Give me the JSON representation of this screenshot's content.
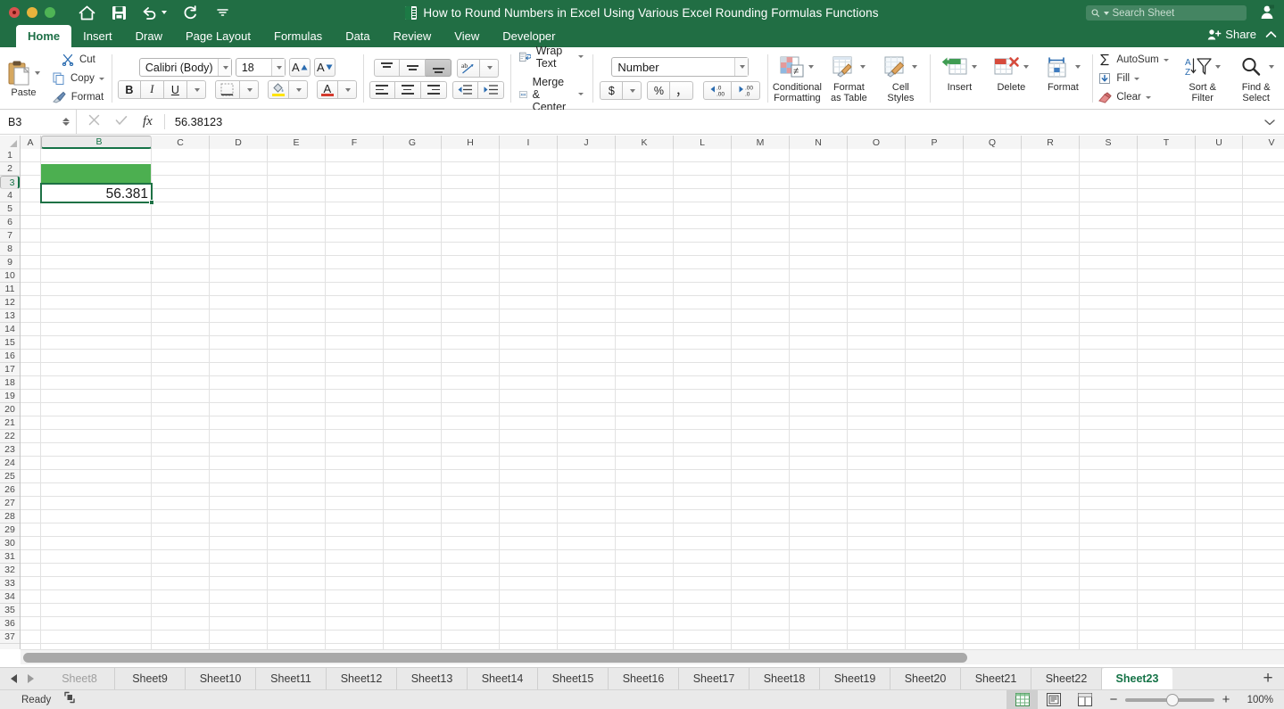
{
  "window": {
    "title": "How to Round Numbers in Excel Using Various Excel Rounding Formulas Functions",
    "traffic_lights": [
      "close",
      "minimize",
      "zoom"
    ],
    "quick_access": [
      "home-icon",
      "save-icon",
      "undo-icon",
      "redo-icon",
      "customize-icon"
    ]
  },
  "search": {
    "placeholder": "Search Sheet",
    "value": ""
  },
  "share": {
    "label": "Share",
    "collapse_icon": "chevron-up-icon",
    "account_icon": "person-icon"
  },
  "tabs": [
    {
      "label": "Home",
      "active": true
    },
    {
      "label": "Insert",
      "active": false
    },
    {
      "label": "Draw",
      "active": false
    },
    {
      "label": "Page Layout",
      "active": false
    },
    {
      "label": "Formulas",
      "active": false
    },
    {
      "label": "Data",
      "active": false
    },
    {
      "label": "Review",
      "active": false
    },
    {
      "label": "View",
      "active": false
    },
    {
      "label": "Developer",
      "active": false
    }
  ],
  "ribbon": {
    "clipboard": {
      "paste": "Paste",
      "cut": "Cut",
      "copy": "Copy",
      "format": "Format"
    },
    "font": {
      "name": "Calibri (Body)",
      "size": "18",
      "grow": "A",
      "shrink": "A",
      "bold": "B",
      "italic": "I",
      "underline": "U"
    },
    "alignment": {
      "top": "align-top",
      "middle": "align-middle",
      "bottom": "align-bottom",
      "orientation": "ab",
      "align_left": "align-left",
      "align_center": "align-center",
      "align_right": "align-right",
      "decrease_indent": "decrease-indent",
      "increase_indent": "increase-indent",
      "wrap_text": "Wrap Text",
      "merge_center": "Merge & Center"
    },
    "number": {
      "format": "Number",
      "currency": "$",
      "percent": "%",
      "comma": ",",
      "increase_decimal": ".00",
      "decrease_decimal": ".00"
    },
    "styles": {
      "conditional_formatting": "Conditional\nFormatting",
      "format_as_table": "Format\nas Table",
      "cell_styles": "Cell\nStyles"
    },
    "cells": {
      "insert": "Insert",
      "delete": "Delete",
      "format": "Format"
    },
    "editing": {
      "autosum": "AutoSum",
      "fill": "Fill",
      "clear": "Clear",
      "sort_filter": "Sort &\nFilter",
      "find_select": "Find &\nSelect"
    }
  },
  "formula_bar": {
    "name_box": "B3",
    "cancel_icon": "close-icon",
    "confirm_icon": "check-icon",
    "fx_icon": "fx-icon",
    "value": "56.38123",
    "collapse_icon": "chevron-down-icon"
  },
  "grid": {
    "columns": [
      "A",
      "B",
      "C",
      "D",
      "E",
      "F",
      "G",
      "H",
      "I",
      "J",
      "K",
      "L",
      "M",
      "N",
      "O",
      "P",
      "Q",
      "R",
      "S",
      "T",
      "U",
      "V"
    ],
    "selected_column": "B",
    "rows": [
      1,
      2,
      3,
      4,
      5,
      6,
      7,
      8,
      9,
      10,
      11,
      12,
      13,
      14,
      15,
      16,
      17,
      18,
      19,
      20,
      21,
      22,
      23,
      24,
      25,
      26,
      27,
      28,
      29,
      30,
      31,
      32,
      33,
      34,
      35,
      36,
      37
    ],
    "selected_row": 3,
    "cells": [
      {
        "ref": "B2",
        "value": "",
        "fill": "#4caf50"
      },
      {
        "ref": "B3",
        "value": "56.381",
        "fill": "#ffffff",
        "selected": true
      }
    ],
    "selection_color": "#1e7145"
  },
  "sheet_tabs": {
    "prev_icon": "arrow-left-icon",
    "next_icon": "arrow-right-icon",
    "add_label": "+",
    "tabs": [
      {
        "label": "Sheet8",
        "active": false,
        "dim": true
      },
      {
        "label": "Sheet9",
        "active": false,
        "dim": false
      },
      {
        "label": "Sheet10",
        "active": false,
        "dim": false
      },
      {
        "label": "Sheet11",
        "active": false,
        "dim": false
      },
      {
        "label": "Sheet12",
        "active": false,
        "dim": false
      },
      {
        "label": "Sheet13",
        "active": false,
        "dim": false
      },
      {
        "label": "Sheet14",
        "active": false,
        "dim": false
      },
      {
        "label": "Sheet15",
        "active": false,
        "dim": false
      },
      {
        "label": "Sheet16",
        "active": false,
        "dim": false
      },
      {
        "label": "Sheet17",
        "active": false,
        "dim": false
      },
      {
        "label": "Sheet18",
        "active": false,
        "dim": false
      },
      {
        "label": "Sheet19",
        "active": false,
        "dim": false
      },
      {
        "label": "Sheet20",
        "active": false,
        "dim": false
      },
      {
        "label": "Sheet21",
        "active": false,
        "dim": false
      },
      {
        "label": "Sheet22",
        "active": false,
        "dim": false
      },
      {
        "label": "Sheet23",
        "active": true,
        "dim": false
      }
    ]
  },
  "status_bar": {
    "state": "Ready",
    "selection_icon": "select-object-icon",
    "views": [
      {
        "name": "normal-view",
        "active": true
      },
      {
        "name": "page-layout-view",
        "active": false
      },
      {
        "name": "page-break-view",
        "active": false
      }
    ],
    "zoom_out": "−",
    "zoom_in": "+",
    "zoom_level": "100%"
  },
  "colors": {
    "titlebar": "#216e44",
    "accent_green": "#157347",
    "cell_fill_green": "#4caf50",
    "selection_border": "#1e7145"
  }
}
